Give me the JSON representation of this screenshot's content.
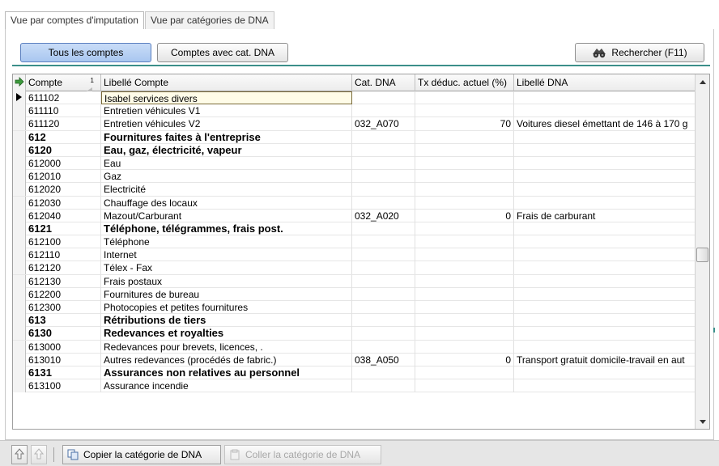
{
  "tabs": [
    {
      "label": "Vue par comptes d'imputation",
      "active": true
    },
    {
      "label": "Vue par catégories de DNA",
      "active": false
    }
  ],
  "toolbar": {
    "tous_comptes": "Tous les comptes",
    "comptes_avec_cat": "Comptes avec cat. DNA",
    "rechercher": "Rechercher (F11)"
  },
  "grid": {
    "headers": {
      "compte": "Compte",
      "sort_index": "1",
      "libelle": "Libellé Compte",
      "cat": "Cat. DNA",
      "tx": "Tx déduc. actuel (%)",
      "libdna": "Libellé DNA"
    },
    "rows": [
      {
        "compte": "611102",
        "libelle": "Isabel services divers",
        "cat": "",
        "tx": "",
        "libdna": "",
        "bold": false,
        "current": true
      },
      {
        "compte": "611110",
        "libelle": "Entretien véhicules V1",
        "cat": "",
        "tx": "",
        "libdna": "",
        "bold": false
      },
      {
        "compte": "611120",
        "libelle": "Entretien véhicules V2",
        "cat": "032_A070",
        "tx": "70",
        "libdna": "Voitures diesel émettant de 146 à 170 g",
        "bold": false
      },
      {
        "compte": "612",
        "libelle": "Fournitures faites à l'entreprise",
        "cat": "",
        "tx": "",
        "libdna": "",
        "bold": true
      },
      {
        "compte": "6120",
        "libelle": "Eau, gaz, électricité, vapeur",
        "cat": "",
        "tx": "",
        "libdna": "",
        "bold": true
      },
      {
        "compte": "612000",
        "libelle": "Eau",
        "cat": "",
        "tx": "",
        "libdna": "",
        "bold": false
      },
      {
        "compte": "612010",
        "libelle": "Gaz",
        "cat": "",
        "tx": "",
        "libdna": "",
        "bold": false
      },
      {
        "compte": "612020",
        "libelle": "Electricité",
        "cat": "",
        "tx": "",
        "libdna": "",
        "bold": false
      },
      {
        "compte": "612030",
        "libelle": "Chauffage des locaux",
        "cat": "",
        "tx": "",
        "libdna": "",
        "bold": false
      },
      {
        "compte": "612040",
        "libelle": "Mazout/Carburant",
        "cat": "032_A020",
        "tx": "0",
        "libdna": "Frais de carburant",
        "bold": false
      },
      {
        "compte": "6121",
        "libelle": "Téléphone, télégrammes, frais post.",
        "cat": "",
        "tx": "",
        "libdna": "",
        "bold": true
      },
      {
        "compte": "612100",
        "libelle": "Téléphone",
        "cat": "",
        "tx": "",
        "libdna": "",
        "bold": false
      },
      {
        "compte": "612110",
        "libelle": "Internet",
        "cat": "",
        "tx": "",
        "libdna": "",
        "bold": false
      },
      {
        "compte": "612120",
        "libelle": "Télex - Fax",
        "cat": "",
        "tx": "",
        "libdna": "",
        "bold": false
      },
      {
        "compte": "612130",
        "libelle": "Frais postaux",
        "cat": "",
        "tx": "",
        "libdna": "",
        "bold": false
      },
      {
        "compte": "612200",
        "libelle": "Fournitures de bureau",
        "cat": "",
        "tx": "",
        "libdna": "",
        "bold": false
      },
      {
        "compte": "612300",
        "libelle": "Photocopies et petites fournitures",
        "cat": "",
        "tx": "",
        "libdna": "",
        "bold": false
      },
      {
        "compte": "613",
        "libelle": "Rétributions de tiers",
        "cat": "",
        "tx": "",
        "libdna": "",
        "bold": true
      },
      {
        "compte": "6130",
        "libelle": "Redevances et royalties",
        "cat": "",
        "tx": "",
        "libdna": "",
        "bold": true
      },
      {
        "compte": "613000",
        "libelle": "Redevances pour brevets, licences, .",
        "cat": "",
        "tx": "",
        "libdna": "",
        "bold": false
      },
      {
        "compte": "613010",
        "libelle": "Autres redevances (procédés de fabric.)",
        "cat": "038_A050",
        "tx": "0",
        "libdna": "Transport gratuit domicile-travail en aut",
        "bold": false
      },
      {
        "compte": "6131",
        "libelle": "Assurances non relatives au personnel",
        "cat": "",
        "tx": "",
        "libdna": "",
        "bold": true
      },
      {
        "compte": "613100",
        "libelle": "Assurance incendie",
        "cat": "",
        "tx": "",
        "libdna": "",
        "bold": false
      }
    ]
  },
  "bottom": {
    "copier": "Copier la catégorie de DNA",
    "coller": "Coller la catégorie de DNA"
  },
  "icons": {
    "header_indicator": "arrow-right-icon",
    "row_current": "row-pointer-icon",
    "rechercher": "binoculars-icon",
    "copier": "copy-icon",
    "coller": "paste-icon",
    "nav_up": "nav-up-icon",
    "nav_down": "nav-down-icon"
  },
  "colors": {
    "accent": "#3b8f8a",
    "pressed_button": "#b7d0f3",
    "header_arrow": "#3c9a3c"
  }
}
